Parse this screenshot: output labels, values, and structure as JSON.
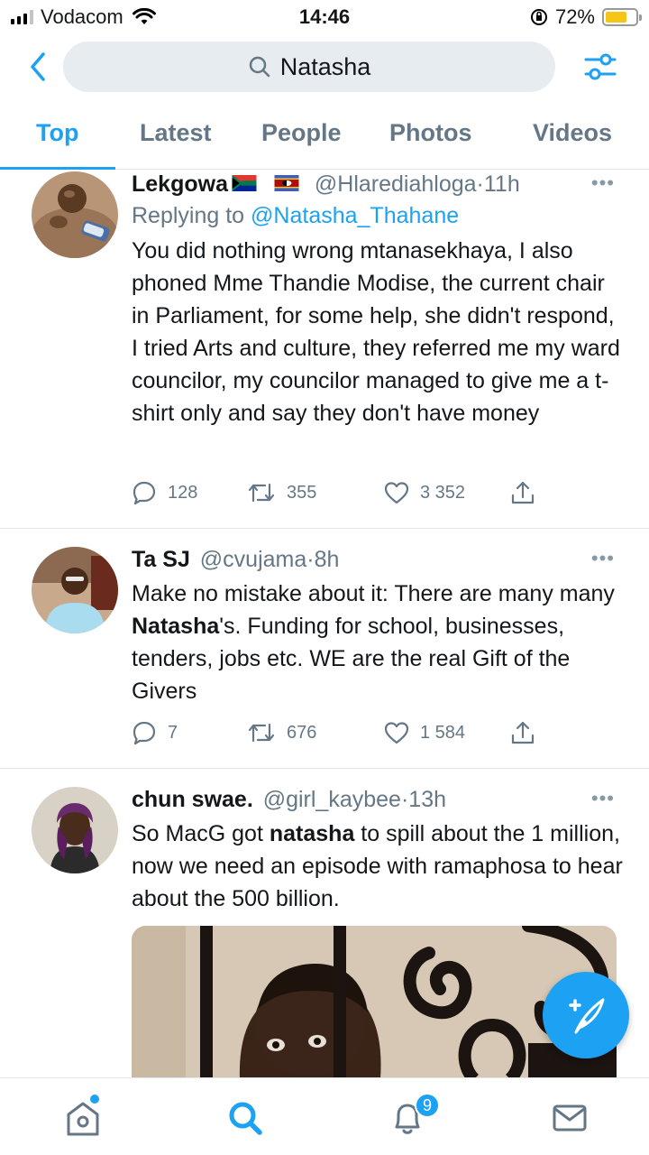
{
  "status_bar": {
    "carrier": "Vodacom",
    "time": "14:46",
    "battery_percent": "72%",
    "battery_level": 0.72
  },
  "search": {
    "query": "Natasha"
  },
  "tabs": [
    {
      "label": "Top",
      "active": true
    },
    {
      "label": "Latest",
      "active": false
    },
    {
      "label": "People",
      "active": false
    },
    {
      "label": "Photos",
      "active": false
    },
    {
      "label": "Videos",
      "active": false
    }
  ],
  "tweets": [
    {
      "name": "Lekgowa",
      "handle": "@Hlarediahloga",
      "dot": "·",
      "time": "11h",
      "replying_prefix": "Replying to ",
      "replying_to": "@Natasha_Thahane",
      "text": "You did nothing wrong mtanasekhaya, I also phoned Mme Thandie Modise, the current chair in Parliament, for some help, she didn't respond, I tried Arts and culture, they referred me my ward councilor, my councilor managed to give me a t-shirt only and say they don't have money",
      "replies": "128",
      "retweets": "355",
      "likes": "3 352"
    },
    {
      "name": "Ta SJ",
      "handle": "@cvujama",
      "dot": "·",
      "time": "8h",
      "text_pre": "Make no mistake about it: There are many many ",
      "text_bold": "Natasha",
      "text_post": "'s. Funding for school, businesses, tenders, jobs etc. WE are the real Gift of the Givers",
      "replies": "7",
      "retweets": "676",
      "likes": "1 584"
    },
    {
      "name": "chun swae.",
      "handle": "@girl_kaybee",
      "dot": "·",
      "time": "13h",
      "text_pre": "So MacG got ",
      "text_bold": "natasha",
      "text_post": " to spill about the 1 million, now we need an episode with ramaphosa to hear about the 500 billion."
    }
  ],
  "more_glyph": "•••",
  "notifications": {
    "badge_count": "9"
  },
  "icons": {
    "back": "chevron-left-icon",
    "search": "search-icon",
    "filter": "sliders-icon",
    "reply": "comment-icon",
    "retweet": "retweet-icon",
    "like": "heart-icon",
    "share": "share-icon",
    "compose": "compose-tweet-icon",
    "home": "home-icon",
    "explore": "explore-search-icon",
    "bell": "bell-icon",
    "messages": "envelope-icon"
  },
  "colors": {
    "accent": "#1da1f2",
    "secondary_text": "#657786",
    "divider": "#e1e8ed"
  }
}
